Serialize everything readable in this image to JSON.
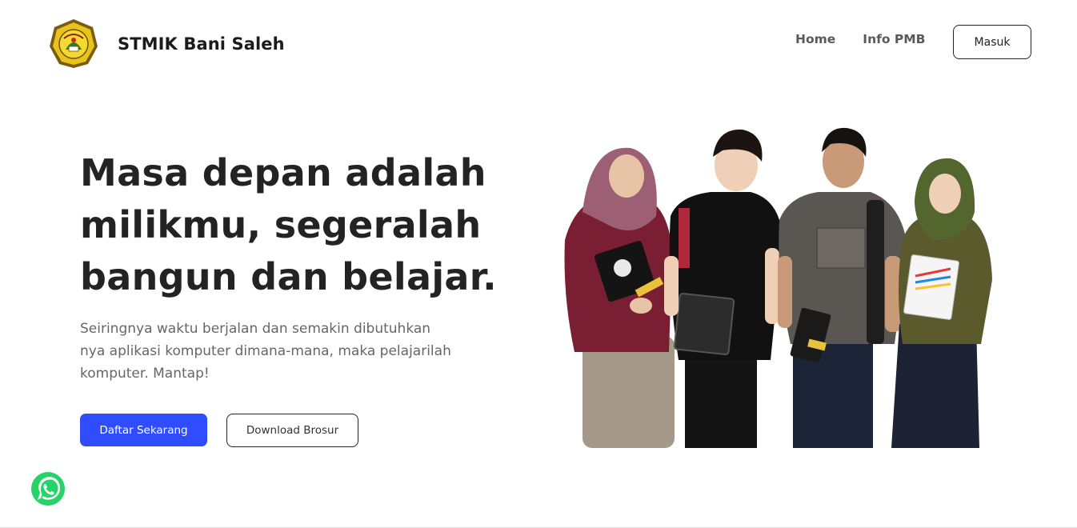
{
  "nav": {
    "brand": "STMIK Bani Saleh",
    "links": [
      "Home",
      "Info PMB"
    ],
    "login_label": "Masuk"
  },
  "hero": {
    "title": "Masa depan adalah milikmu, segeralah bangun dan belajar.",
    "description": "Seiringnya waktu berjalan dan semakin dibutuhkan nya aplikasi komputer dimana-mana, maka pelajarilah komputer. Mantap!",
    "primary_label": "Daftar Sekarang",
    "secondary_label": "Download Brosur"
  },
  "colors": {
    "primary": "#2f4dff",
    "whatsapp": "#25d366",
    "logo_gold": "#e9c21a"
  },
  "icons": {
    "logo": "college-crest-logo",
    "whatsapp": "whatsapp-icon"
  }
}
